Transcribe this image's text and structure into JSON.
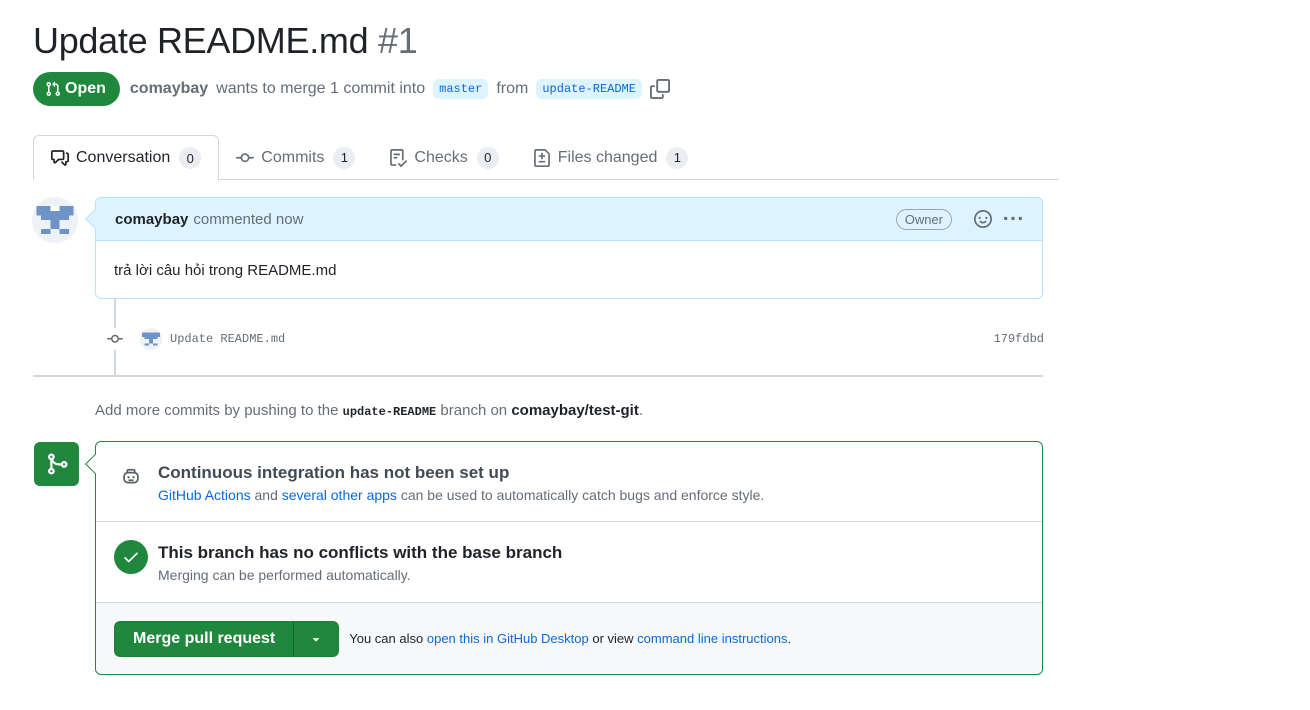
{
  "pr": {
    "title": "Update README.md",
    "number": "#1",
    "state": "Open",
    "author": "comaybay",
    "merge_text": "wants to merge 1 commit into",
    "base_branch": "master",
    "from_text": "from",
    "head_branch": "update-README"
  },
  "tabs": [
    {
      "label": "Conversation",
      "count": "0",
      "icon": "comment-discussion-icon"
    },
    {
      "label": "Commits",
      "count": "1",
      "icon": "git-commit-icon"
    },
    {
      "label": "Checks",
      "count": "0",
      "icon": "checklist-icon"
    },
    {
      "label": "Files changed",
      "count": "1",
      "icon": "file-diff-icon"
    }
  ],
  "comment": {
    "author": "comaybay",
    "action": "commented now",
    "badge": "Owner",
    "body": "trả lời câu hỏi trong README.md"
  },
  "commit": {
    "message": "Update README.md",
    "sha": "179fdbd"
  },
  "push_hint": {
    "prefix": "Add more commits by pushing to the",
    "branch": "update-README",
    "middle": "branch on",
    "repo": "comaybay/test-git",
    "suffix": "."
  },
  "merge": {
    "ci_title": "Continuous integration has not been set up",
    "ci_link1": "GitHub Actions",
    "ci_and": "and",
    "ci_link2": "several other apps",
    "ci_rest": "can be used to automatically catch bugs and enforce style.",
    "conflict_title": "This branch has no conflicts with the base branch",
    "conflict_sub": "Merging can be performed automatically.",
    "button": "Merge pull request",
    "note_prefix": "You can also",
    "note_link1": "open this in GitHub Desktop",
    "note_mid": "or view",
    "note_link2": "command line instructions",
    "note_suffix": "."
  },
  "colors": {
    "open_green": "#1f883d",
    "link_blue": "#0969da",
    "header_blue": "#ddf4ff"
  }
}
